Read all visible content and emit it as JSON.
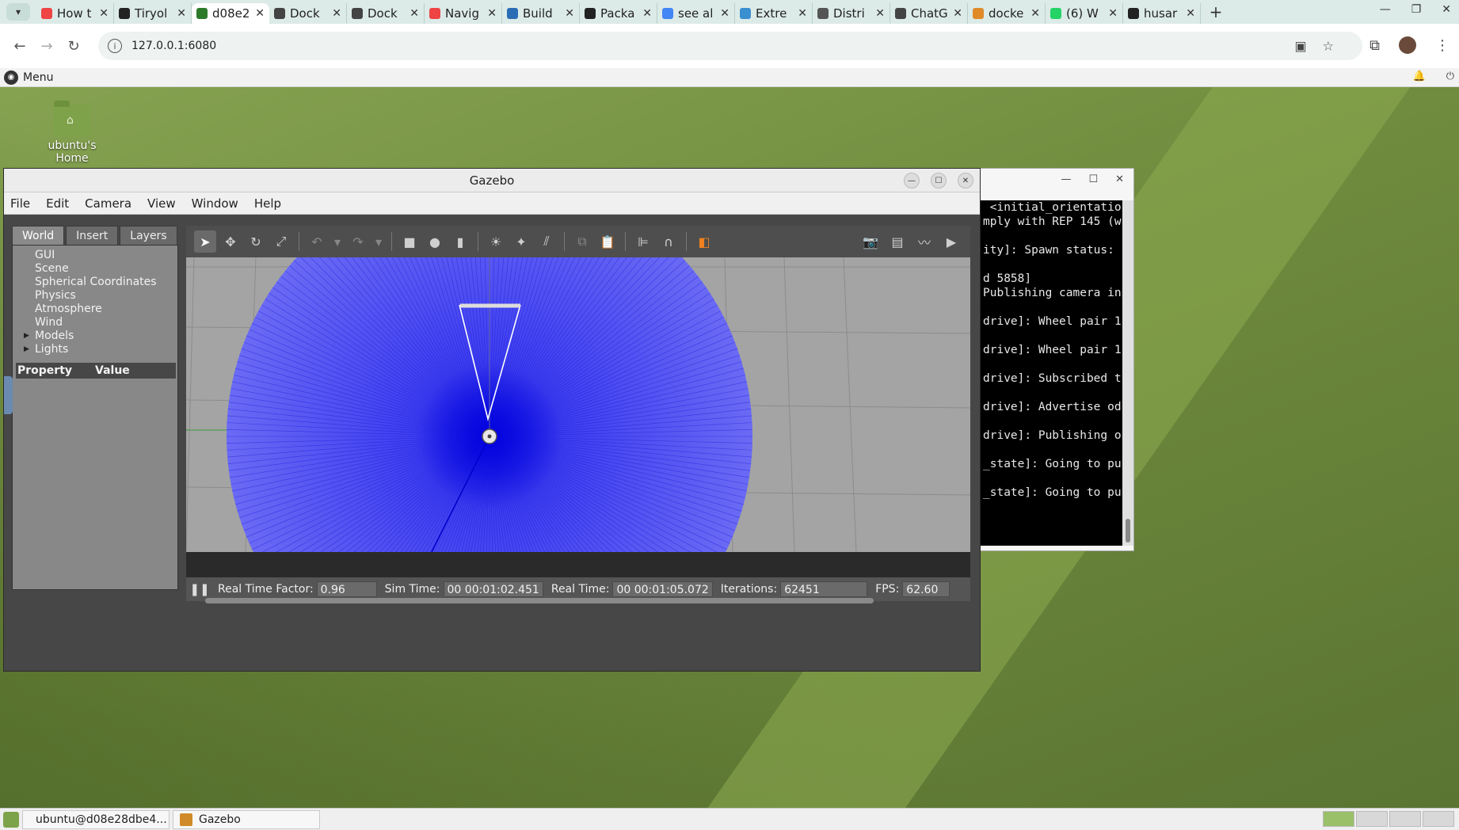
{
  "browser": {
    "tabs": [
      {
        "label": "How t",
        "fav_color": "#e44"
      },
      {
        "label": "Tiryol",
        "fav_color": "#222"
      },
      {
        "label": "d08e2",
        "fav_color": "#2a7a2a",
        "active": true
      },
      {
        "label": "Dock",
        "fav_color": "#444"
      },
      {
        "label": "Dock",
        "fav_color": "#444"
      },
      {
        "label": "Navig",
        "fav_color": "#e44"
      },
      {
        "label": "Build",
        "fav_color": "#2a6db5"
      },
      {
        "label": "Packa",
        "fav_color": "#222"
      },
      {
        "label": "see al",
        "fav_color": "#4285f4"
      },
      {
        "label": "Extre",
        "fav_color": "#3a8fd0"
      },
      {
        "label": "Distri",
        "fav_color": "#555"
      },
      {
        "label": "ChatG",
        "fav_color": "#444"
      },
      {
        "label": "docke",
        "fav_color": "#e08a2a"
      },
      {
        "label": "(6) W",
        "fav_color": "#25d366"
      },
      {
        "label": "husar",
        "fav_color": "#222"
      }
    ],
    "new_tab": "+",
    "url": "127.0.0.1:6080"
  },
  "desktop": {
    "menu_label": "Menu",
    "home_icon_label": "ubuntu's Home"
  },
  "terminal": {
    "lines": [
      " <initial_orientatio",
      "mply with REP 145 (w",
      "",
      "ity]: Spawn status:",
      "",
      "d 5858]",
      "Publishing camera in",
      "",
      "drive]: Wheel pair 1",
      "",
      "drive]: Wheel pair 1",
      "",
      "drive]: Subscribed t",
      "",
      "drive]: Advertise od",
      "",
      "drive]: Publishing o",
      "",
      "_state]: Going to pu",
      "",
      "_state]: Going to pu"
    ]
  },
  "gazebo": {
    "title": "Gazebo",
    "menus": [
      "File",
      "Edit",
      "Camera",
      "View",
      "Window",
      "Help"
    ],
    "left_tabs": [
      "World",
      "Insert",
      "Layers"
    ],
    "tree_items": [
      {
        "label": "GUI",
        "expandable": false
      },
      {
        "label": "Scene",
        "expandable": false
      },
      {
        "label": "Spherical Coordinates",
        "expandable": false
      },
      {
        "label": "Physics",
        "expandable": false
      },
      {
        "label": "Atmosphere",
        "expandable": false
      },
      {
        "label": "Wind",
        "expandable": false
      },
      {
        "label": "Models",
        "expandable": true
      },
      {
        "label": "Lights",
        "expandable": true
      }
    ],
    "property_header": "Property",
    "value_header": "Value",
    "status": {
      "rtf_label": "Real Time Factor:",
      "rtf_value": "0.96",
      "sim_time_label": "Sim Time:",
      "sim_time_value": "00 00:01:02.451",
      "real_time_label": "Real Time:",
      "real_time_value": "00 00:01:05.072",
      "iterations_label": "Iterations:",
      "iterations_value": "62451",
      "fps_label": "FPS:",
      "fps_value": "62.60"
    }
  },
  "taskbar": {
    "tasks": [
      {
        "label": "ubuntu@d08e28dbe4...",
        "icon_color": "#c22"
      },
      {
        "label": "Gazebo",
        "icon_color": "#d08a2a"
      }
    ]
  },
  "colors": {
    "laser_blue": "#3a3af0",
    "desktop_green": "#6d8a3c"
  }
}
